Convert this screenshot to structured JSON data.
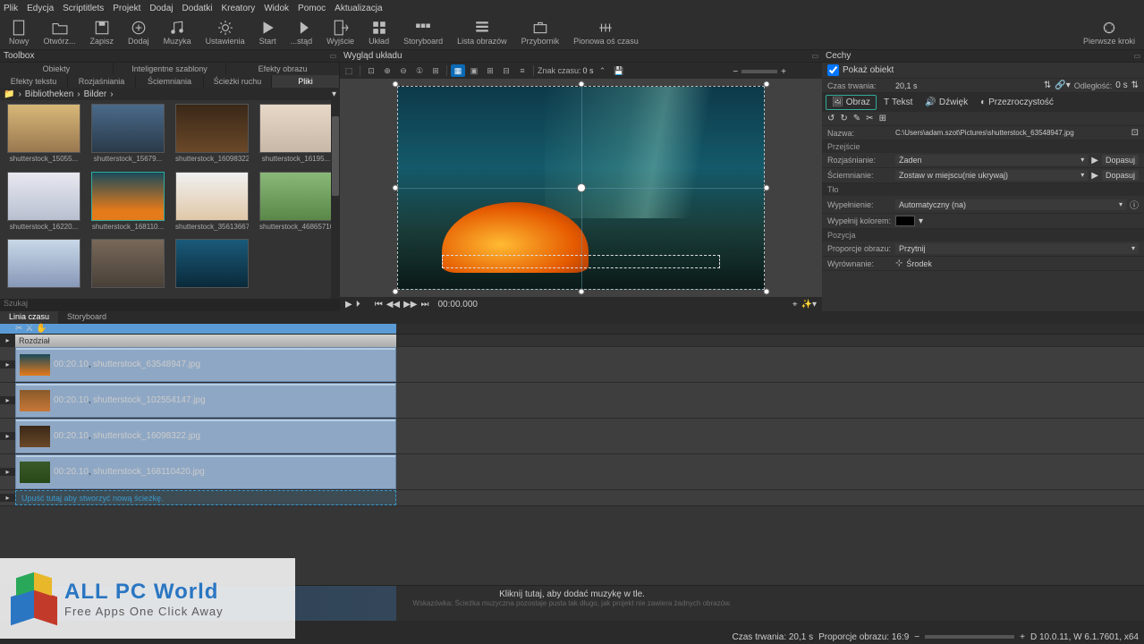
{
  "menu": [
    "Plik",
    "Edycja",
    "Scriptitlets",
    "Projekt",
    "Dodaj",
    "Dodatki",
    "Kreatory",
    "Widok",
    "Pomoc",
    "Aktualizacja"
  ],
  "toolbar": [
    {
      "icon": "file",
      "label": "Nowy"
    },
    {
      "icon": "folder",
      "label": "Otwórz..."
    },
    {
      "icon": "save",
      "label": "Zapisz"
    },
    {
      "icon": "plus",
      "label": "Dodaj"
    },
    {
      "icon": "music",
      "label": "Muzyka"
    },
    {
      "icon": "gear",
      "label": "Ustawienia"
    },
    {
      "icon": "play",
      "label": "Start"
    },
    {
      "icon": "stepf",
      "label": "...stąd"
    },
    {
      "icon": "door",
      "label": "Wyjście"
    },
    {
      "icon": "grid",
      "label": "Układ"
    },
    {
      "icon": "story",
      "label": "Storyboard"
    },
    {
      "icon": "list",
      "label": "Lista obrazów"
    },
    {
      "icon": "box",
      "label": "Przybornik"
    },
    {
      "icon": "timeline",
      "label": "Pionowa oś czasu"
    }
  ],
  "toolbar_right": {
    "label": "Pierwsze kroki"
  },
  "toolbox": {
    "title": "Toolbox",
    "row1": [
      "Obiekty",
      "Inteligentne szablony",
      "Efekty obrazu"
    ],
    "row2": [
      "Efekty tekstu",
      "Rozjaśniania",
      "Ściemniania",
      "Ścieżki ruchu",
      "Pliki"
    ],
    "active": "Pliki",
    "crumbs": [
      "Bibliotheken",
      "Bilder"
    ],
    "thumbs": [
      "shutterstock_15055...",
      "shutterstock_15679...",
      "shutterstock_16098322",
      "shutterstock_16195...",
      "shutterstock_16220...",
      "shutterstock_168110...",
      "shutterstock_35613667",
      "shutterstock_46865710",
      "",
      "",
      "",
      ""
    ],
    "selected": 5,
    "search": "Szukaj"
  },
  "preview": {
    "title": "Wygląd układu",
    "time_label": "Znak czasu:",
    "time_val": "0 s",
    "timecode": "00:00.000"
  },
  "props": {
    "title": "Cechy",
    "show_obj": "Pokaż obiekt",
    "duration_lbl": "Czas trwania:",
    "duration_val": "20,1 s",
    "offset_lbl": "Odległość:",
    "offset_val": "0 s",
    "tabs": [
      "Obraz",
      "Tekst",
      "Dźwięk",
      "Przezroczystość"
    ],
    "name_lbl": "Nazwa:",
    "name_val": "C:\\Users\\adam.szot\\Pictures\\shutterstock_63548947.jpg",
    "sec_transition": "Przejście",
    "fadein_lbl": "Rozjaśnianie:",
    "fadein_val": "Żaden",
    "dopasuj": "Dopasuj",
    "fadeout_lbl": "Ściemnianie:",
    "fadeout_val": "Zostaw w miejscu(nie ukrywaj)",
    "sec_bg": "Tło",
    "fill_lbl": "Wypełnienie:",
    "fill_val": "Automatyczny (na)",
    "fillcolor_lbl": "Wypełnij kolorem:",
    "sec_pos": "Pozycja",
    "aspect_lbl": "Proporcje obrazu:",
    "aspect_val": "Przytnij",
    "align_lbl": "Wyrównanie:",
    "align_val": "Środek"
  },
  "timeline": {
    "tabs": [
      "Linia czasu",
      "Storyboard"
    ],
    "chapter": "Rozdział",
    "clips": [
      {
        "d": "00:20.10",
        "n": "shutterstock_63548947.jpg"
      },
      {
        "d": "00:20.10",
        "n": "shutterstock_102554147.jpg"
      },
      {
        "d": "00:20.10",
        "n": "shutterstock_16098322.jpg"
      },
      {
        "d": "00:20.10",
        "n": "shutterstock_168110420.jpg"
      }
    ],
    "drop": "Upuść tutaj aby stworzyć nową ścieżkę.",
    "music_hint1": "Kliknij tutaj, aby dodać muzykę w tle.",
    "music_hint2": "Wskazówka: Ścieżka muzyczna pozostaje pusta tak długo, jak projekt nie zawiera żadnych obrazów.",
    "status": {
      "dur": "Czas trwania: 20,1 s",
      "aspect": "Proporcje obrazu: 16:9",
      "ver": "D 10.0.11, W 6.1.7601, x64"
    }
  },
  "watermark": {
    "t1": "ALL PC World",
    "t2": "Free Apps One Click Away"
  }
}
